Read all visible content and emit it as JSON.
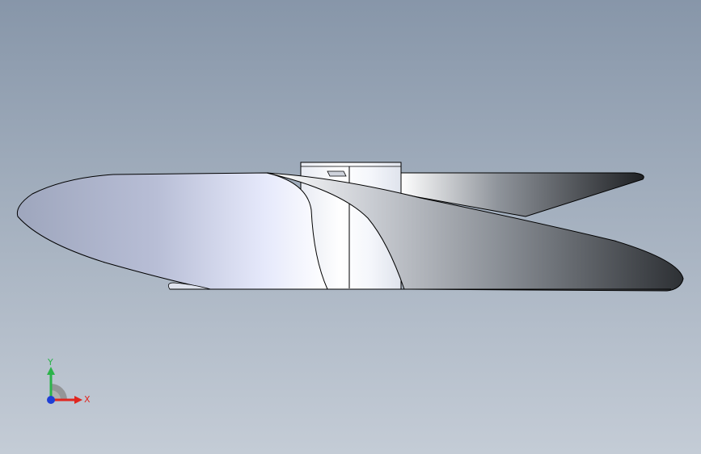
{
  "viewport": {
    "background_top": "#8796a9",
    "background_bottom": "#c4ccd6"
  },
  "model": {
    "name": "propeller",
    "blade_count": 3,
    "edge_color": "#000000"
  },
  "triad": {
    "x_label": "X",
    "y_label": "Y",
    "x_color": "#e0261f",
    "y_color": "#2bb34a",
    "z_color": "#1f3fd6"
  }
}
